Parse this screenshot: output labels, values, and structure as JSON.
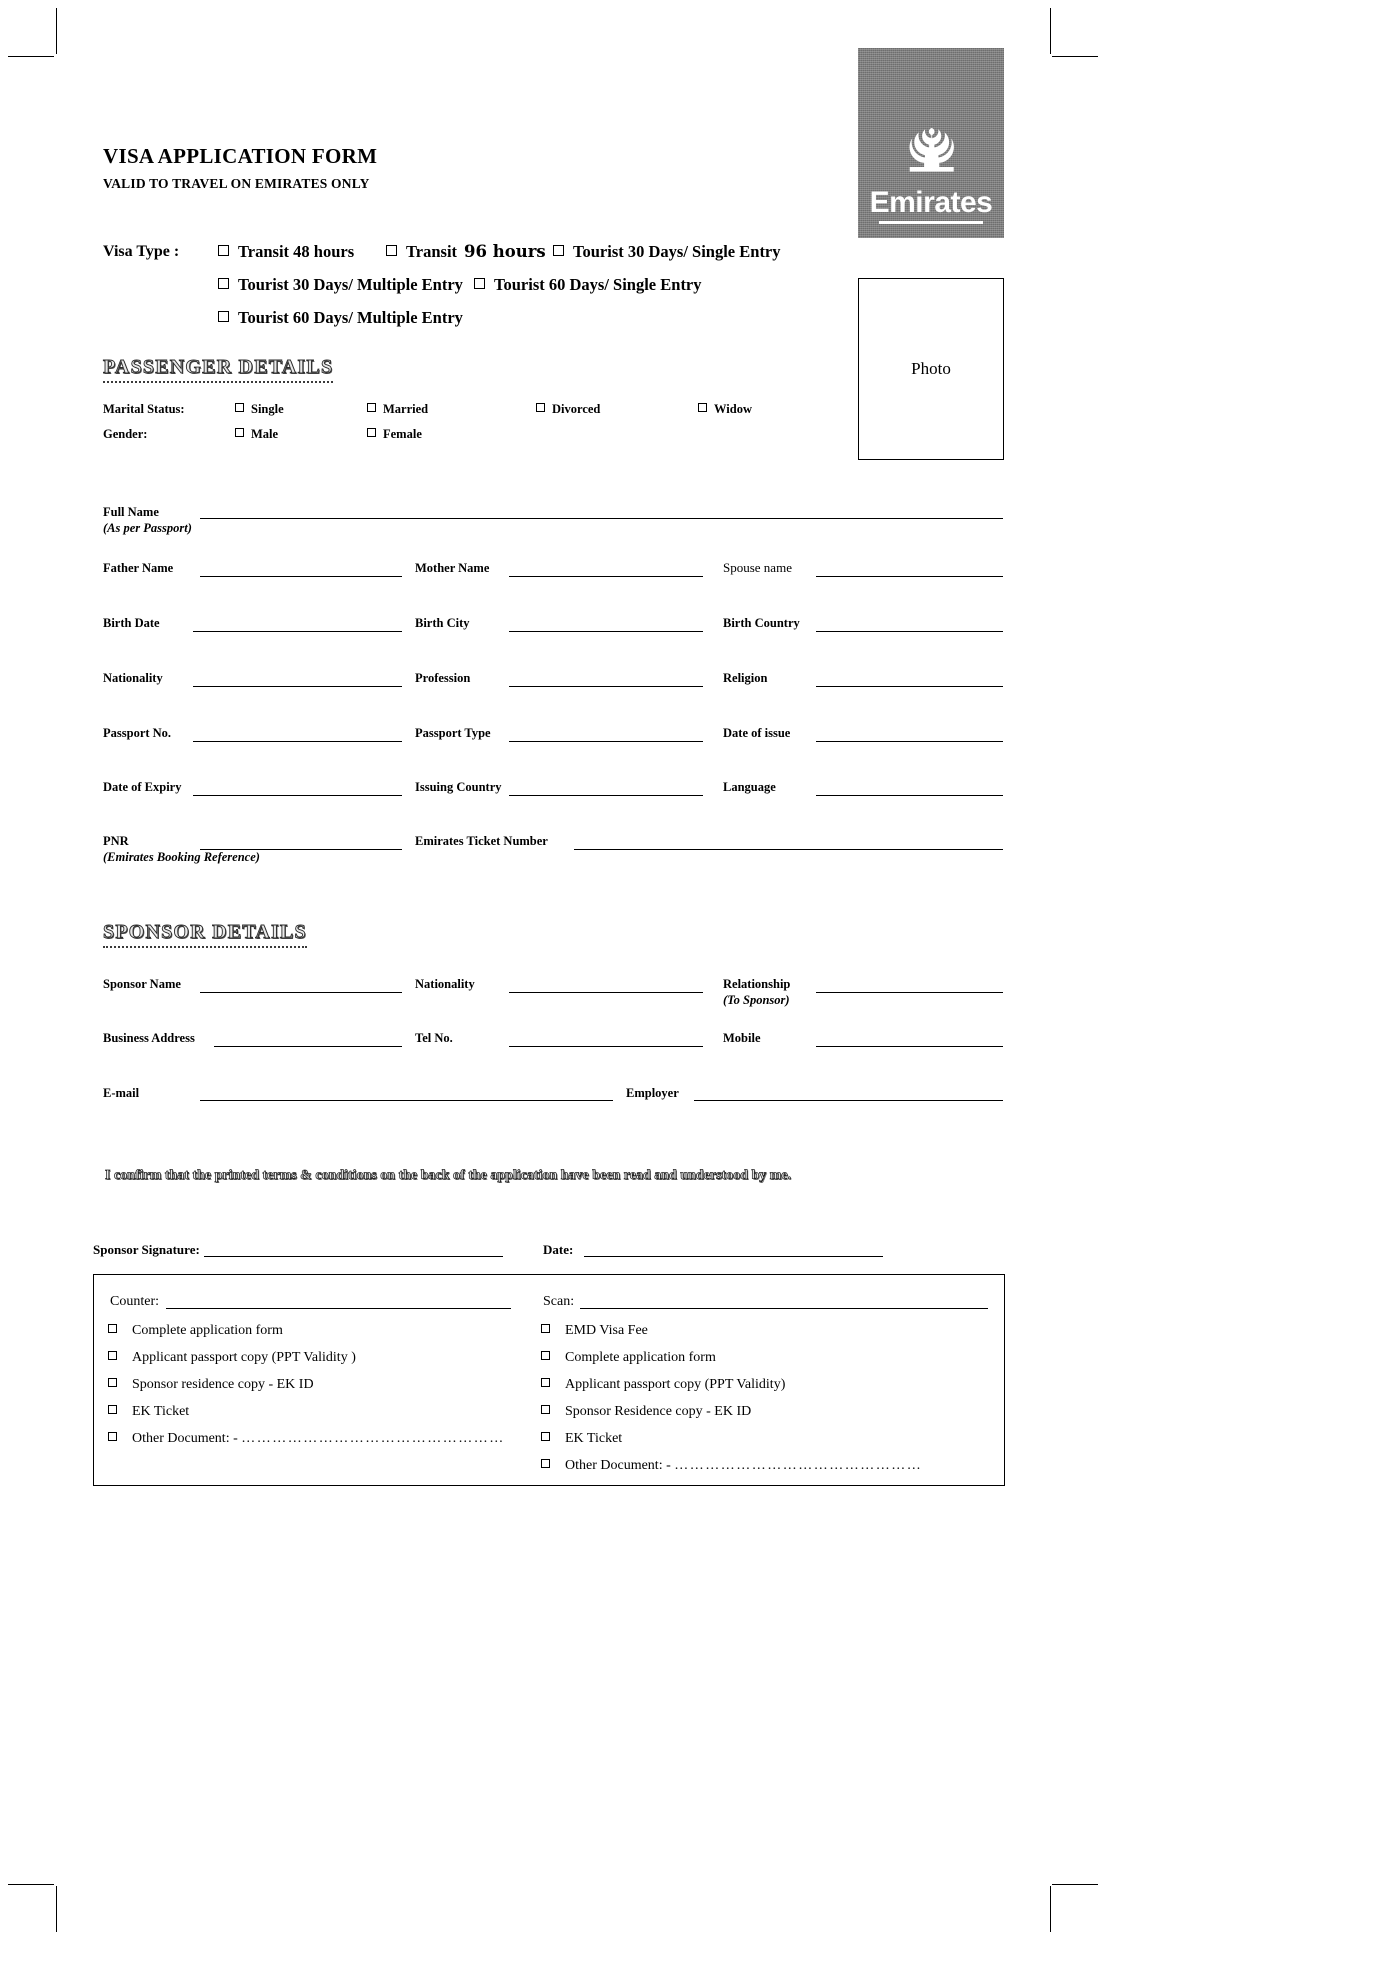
{
  "header": {
    "title": "VISA APPLICATION FORM",
    "subtitle": "VALID TO TRAVEL ON EMIRATES ONLY",
    "logo_wordmark": "Emirates",
    "logo_icon": "emirates-calligraphy-mark"
  },
  "photo": {
    "label": "Photo"
  },
  "visa_type": {
    "label": "Visa Type :",
    "options": [
      {
        "label": "Transit 48 hours"
      },
      {
        "label_prefix": "Transit",
        "label_emph": "96 hours",
        "label": "Transit 96 hours"
      },
      {
        "label": "Tourist 30 Days/ Single Entry"
      },
      {
        "label": "Tourist 30 Days/ Multiple Entry"
      },
      {
        "label": "Tourist 60 Days/ Single Entry"
      },
      {
        "label": "Tourist 60 Days/ Multiple Entry"
      }
    ]
  },
  "passenger": {
    "heading": "PASSENGER DETAILS",
    "marital_label": "Marital Status:",
    "marital_options": [
      "Single",
      "Married",
      "Divorced",
      "Widow"
    ],
    "gender_label": "Gender:",
    "gender_options": [
      "Male",
      "Female"
    ],
    "full_name": {
      "label": "Full Name",
      "note": "(As per Passport)"
    },
    "rows": [
      {
        "c1": "Father Name",
        "c2": "Mother Name",
        "c3": "Spouse name"
      },
      {
        "c1": "Birth Date",
        "c2": "Birth City",
        "c3": "Birth Country"
      },
      {
        "c1": "Nationality",
        "c2": "Profession",
        "c3": "Religion"
      },
      {
        "c1": "Passport No.",
        "c2": "Passport Type",
        "c3": "Date of issue"
      },
      {
        "c1": "Date of Expiry",
        "c2": "Issuing Country",
        "c3": "Language"
      }
    ],
    "pnr": {
      "label": "PNR",
      "note": "(Emirates Booking Reference)"
    },
    "ticket": {
      "label": "Emirates Ticket Number"
    }
  },
  "sponsor": {
    "heading": "SPONSOR DETAILS",
    "rows": [
      {
        "c1": "Sponsor Name",
        "c2": "Nationality",
        "c3": "Relationship",
        "c3_note": "(To Sponsor)"
      },
      {
        "c1": "Business Address",
        "c2": "Tel No.",
        "c3": "Mobile"
      }
    ],
    "email_label": "E-mail",
    "employer_label": "Employer"
  },
  "confirm_text": "I confirm that the printed terms & conditions on the back of the application have been read and understood by me.",
  "signature": {
    "sponsor_signature_label": "Sponsor  Signature:",
    "date_label": "Date:"
  },
  "checklist": {
    "counter": {
      "label": "Counter:",
      "items": [
        {
          "text": "Complete application form"
        },
        {
          "text": "Applicant passport copy (PPT Validity )"
        },
        {
          "text": "Sponsor residence copy  - EK ID"
        },
        {
          "text": "EK Ticket"
        },
        {
          "text": "Other Document: - ",
          "dots": "……………………………………………"
        }
      ]
    },
    "scan": {
      "label": "Scan:",
      "items": [
        {
          "text": "EMD Visa Fee"
        },
        {
          "text": "Complete application form"
        },
        {
          "text": "Applicant passport copy (PPT Validity)"
        },
        {
          "text": "Sponsor Residence copy  - EK ID"
        },
        {
          "text": "EK Ticket"
        },
        {
          "text": "Other Document: - ",
          "dots": "…………………………………………"
        }
      ]
    }
  }
}
